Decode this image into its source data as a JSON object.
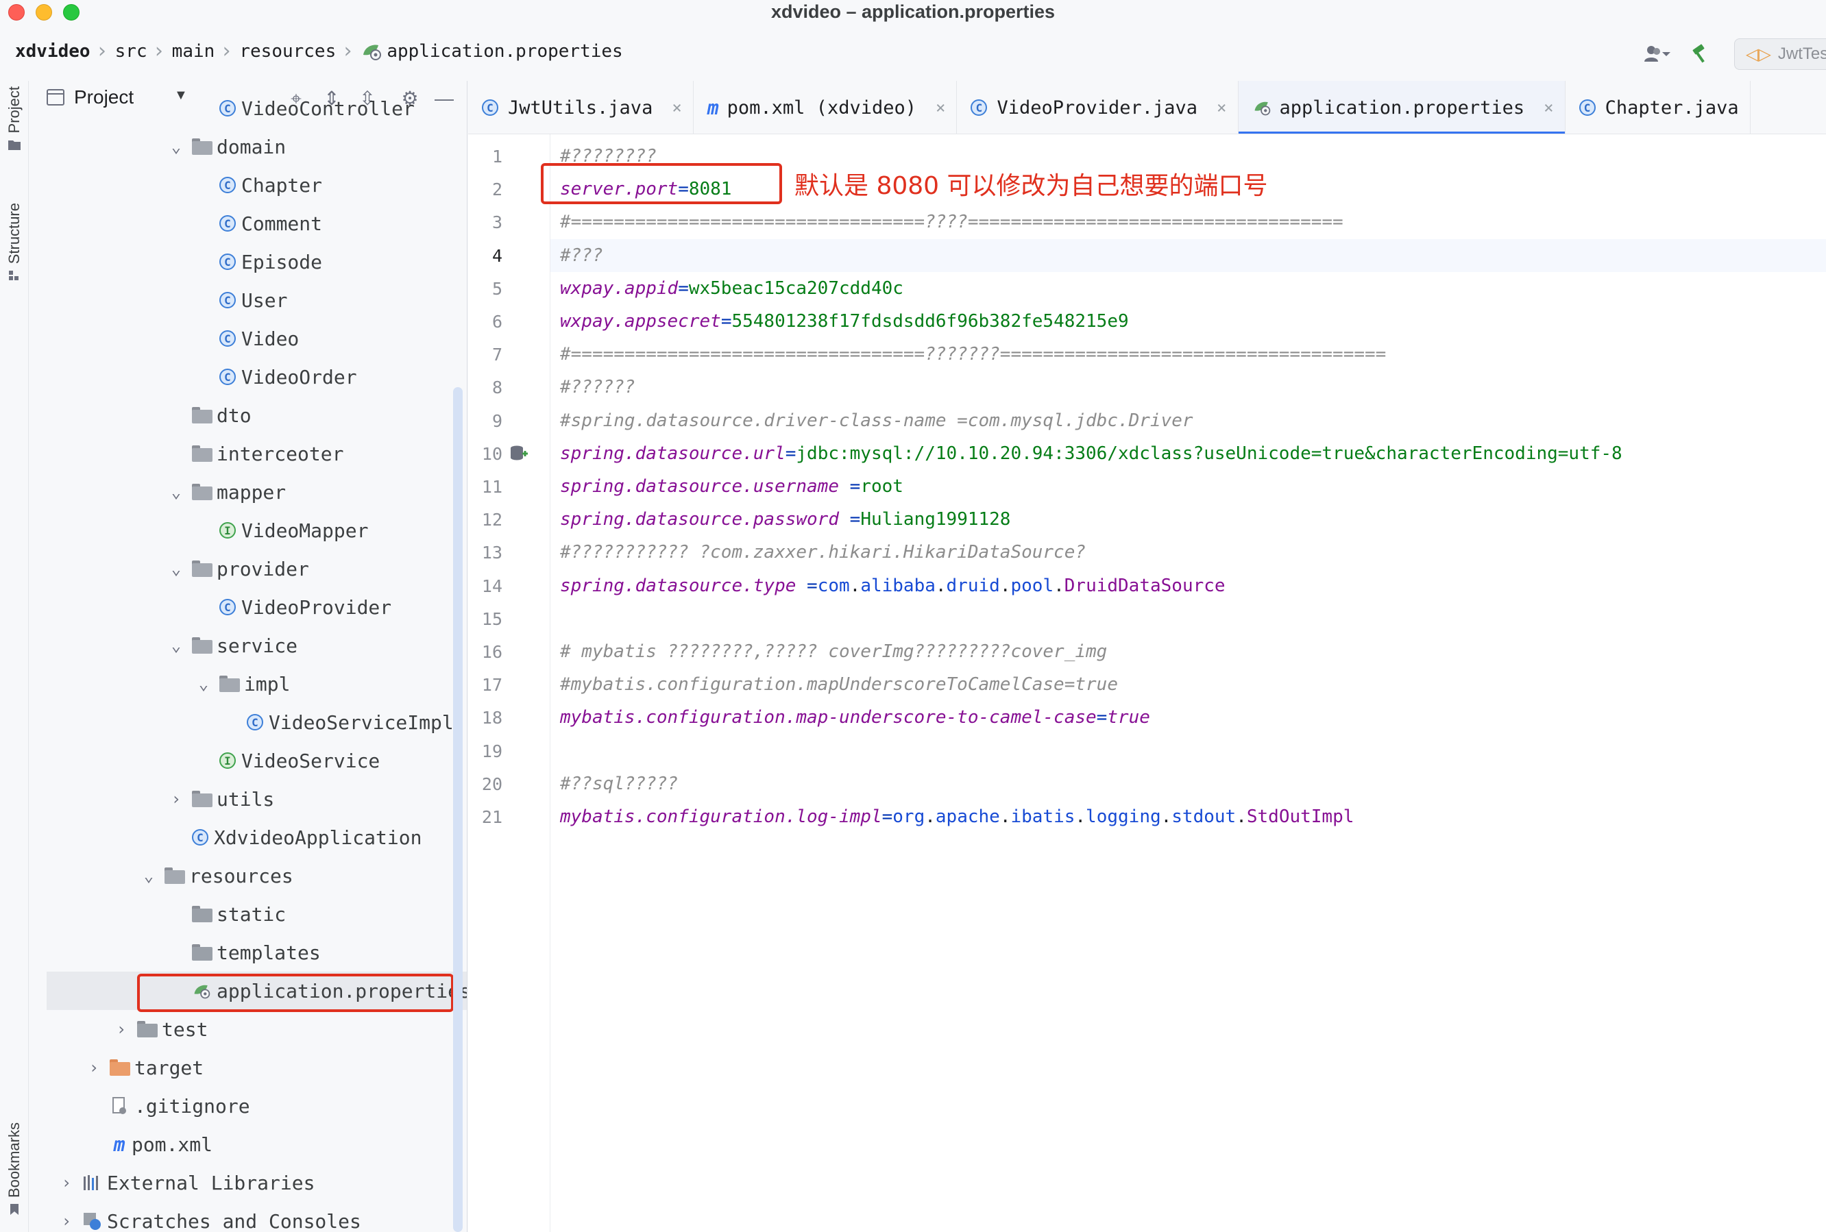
{
  "window": {
    "title": "xdvideo – application.properties"
  },
  "breadcrumb": [
    "xdvideo",
    "src",
    "main",
    "resources",
    "application.properties"
  ],
  "nav_right": {
    "run_config": "JwtTes"
  },
  "tool_strip": {
    "project_label": "Project",
    "structure_label": "Structure",
    "bookmarks_label": "Bookmarks"
  },
  "project_panel": {
    "title": "Project",
    "tree": [
      {
        "label": "VideoController",
        "type": "class",
        "indent": 3
      },
      {
        "label": "domain",
        "type": "package",
        "indent": 2,
        "expanded": true
      },
      {
        "label": "Chapter",
        "type": "class",
        "indent": 3
      },
      {
        "label": "Comment",
        "type": "class",
        "indent": 3
      },
      {
        "label": "Episode",
        "type": "class",
        "indent": 3
      },
      {
        "label": "User",
        "type": "class",
        "indent": 3
      },
      {
        "label": "Video",
        "type": "class",
        "indent": 3
      },
      {
        "label": "VideoOrder",
        "type": "class",
        "indent": 3
      },
      {
        "label": "dto",
        "type": "package",
        "indent": 2
      },
      {
        "label": "interceoter",
        "type": "package",
        "indent": 2
      },
      {
        "label": "mapper",
        "type": "package",
        "indent": 2,
        "expanded": true
      },
      {
        "label": "VideoMapper",
        "type": "interface",
        "indent": 3
      },
      {
        "label": "provider",
        "type": "package",
        "indent": 2,
        "expanded": true
      },
      {
        "label": "VideoProvider",
        "type": "class",
        "indent": 3
      },
      {
        "label": "service",
        "type": "package",
        "indent": 2,
        "expanded": true
      },
      {
        "label": "impl",
        "type": "package",
        "indent": 3,
        "expanded": true
      },
      {
        "label": "VideoServiceImpl",
        "type": "class",
        "indent": 4
      },
      {
        "label": "VideoService",
        "type": "interface",
        "indent": 3
      },
      {
        "label": "utils",
        "type": "package",
        "indent": 2,
        "collapsed": true
      },
      {
        "label": "XdvideoApplication",
        "type": "app",
        "indent": 2
      },
      {
        "label": "resources",
        "type": "resources",
        "indent": 1,
        "expanded": true
      },
      {
        "label": "static",
        "type": "folder",
        "indent": 2
      },
      {
        "label": "templates",
        "type": "folder",
        "indent": 2
      },
      {
        "label": "application.properties",
        "type": "properties",
        "indent": 2,
        "selected": true
      },
      {
        "label": "test",
        "type": "folder",
        "indent": 0,
        "collapsed": true
      },
      {
        "label": "target",
        "type": "orange-folder",
        "indent": -1,
        "collapsed": true
      },
      {
        "label": ".gitignore",
        "type": "gitignore",
        "indent": -1
      },
      {
        "label": "pom.xml",
        "type": "maven",
        "indent": -1
      },
      {
        "label": "External Libraries",
        "type": "libs",
        "indent": -2,
        "collapsed": true
      },
      {
        "label": "Scratches and Consoles",
        "type": "scratch",
        "indent": -2,
        "collapsed": true
      }
    ]
  },
  "tabs": [
    {
      "label": "JwtUtils.java",
      "icon": "class-icon",
      "closable": true
    },
    {
      "label": "pom.xml (xdvideo)",
      "icon": "maven-icon",
      "closable": true
    },
    {
      "label": "VideoProvider.java",
      "icon": "class-icon",
      "closable": true
    },
    {
      "label": "application.properties",
      "icon": "properties-icon",
      "closable": true,
      "active": true
    },
    {
      "label": "Chapter.java",
      "icon": "class-icon",
      "closable": false
    }
  ],
  "editor": {
    "current_line": 4,
    "lines": [
      {
        "n": "1",
        "tokens": [
          [
            "c",
            "#????????"
          ]
        ]
      },
      {
        "n": "2",
        "tokens": [
          [
            "k",
            "server.port"
          ],
          [
            "eq",
            "="
          ],
          [
            "v",
            "8081"
          ]
        ]
      },
      {
        "n": "3",
        "tokens": [
          [
            "c",
            "#=================================????==================================="
          ]
        ]
      },
      {
        "n": "4",
        "tokens": [
          [
            "c",
            "#???"
          ]
        ]
      },
      {
        "n": "5",
        "tokens": [
          [
            "k",
            "wxpay.appid"
          ],
          [
            "eq",
            "="
          ],
          [
            "v",
            "wx5beac15ca207cdd40c"
          ]
        ]
      },
      {
        "n": "6",
        "tokens": [
          [
            "k",
            "wxpay.appsecret"
          ],
          [
            "eq",
            "="
          ],
          [
            "v",
            "554801238f17fdsdsdd6f96b382fe548215e9"
          ]
        ]
      },
      {
        "n": "7",
        "tokens": [
          [
            "c",
            "#=================================???????===================================="
          ]
        ]
      },
      {
        "n": "8",
        "tokens": [
          [
            "c",
            "#??????"
          ]
        ]
      },
      {
        "n": "9",
        "tokens": [
          [
            "c",
            "#spring.datasource.driver-class-name =com.mysql.jdbc.Driver"
          ]
        ]
      },
      {
        "n": "10",
        "tokens": [
          [
            "k",
            "spring.datasource.url"
          ],
          [
            "eq",
            "="
          ],
          [
            "v",
            "jdbc:mysql://10.10.20.94:3306/xdclass?useUnicode=true&characterEncoding=utf-8"
          ]
        ],
        "gutter_icon": "database-icon"
      },
      {
        "n": "11",
        "tokens": [
          [
            "k",
            "spring.datasource.username"
          ],
          [
            "eq",
            " ="
          ],
          [
            "v",
            "root"
          ]
        ]
      },
      {
        "n": "12",
        "tokens": [
          [
            "k",
            "spring.datasource.password"
          ],
          [
            "eq",
            " ="
          ],
          [
            "v",
            "Huliang1991128"
          ]
        ]
      },
      {
        "n": "13",
        "tokens": [
          [
            "c",
            "#??????????? ?com.zaxxer.hikari.HikariDataSource?"
          ]
        ]
      },
      {
        "n": "14",
        "tokens": [
          [
            "k",
            "spring.datasource.type"
          ],
          [
            "eq",
            " ="
          ],
          [
            "pkgv",
            "com"
          ],
          [
            "dark",
            "."
          ],
          [
            "pkgv",
            "alibaba"
          ],
          [
            "dark",
            "."
          ],
          [
            "pkgv",
            "druid"
          ],
          [
            "dark",
            "."
          ],
          [
            "pkgv",
            "pool"
          ],
          [
            "dark",
            "."
          ],
          [
            "clsv",
            "DruidDataSource"
          ]
        ]
      },
      {
        "n": "15",
        "tokens": []
      },
      {
        "n": "16",
        "tokens": [
          [
            "c",
            "# mybatis ????????,????? coverImg?????????cover_img"
          ]
        ]
      },
      {
        "n": "17",
        "tokens": [
          [
            "c",
            "#mybatis.configuration.mapUnderscoreToCamelCase=true"
          ]
        ]
      },
      {
        "n": "18",
        "tokens": [
          [
            "k",
            "mybatis.configuration.map-underscore-to-camel-case"
          ],
          [
            "eq",
            "="
          ],
          [
            "k2",
            "true"
          ]
        ]
      },
      {
        "n": "19",
        "tokens": []
      },
      {
        "n": "20",
        "tokens": [
          [
            "c",
            "#??sql?????"
          ]
        ]
      },
      {
        "n": "21",
        "tokens": [
          [
            "k",
            "mybatis.configuration.log-impl"
          ],
          [
            "eq",
            "="
          ],
          [
            "pkgv",
            "org"
          ],
          [
            "dark",
            "."
          ],
          [
            "pkgv",
            "apache"
          ],
          [
            "dark",
            "."
          ],
          [
            "pkgv",
            "ibatis"
          ],
          [
            "dark",
            "."
          ],
          [
            "pkgv",
            "logging"
          ],
          [
            "dark",
            "."
          ],
          [
            "pkgv",
            "stdout"
          ],
          [
            "dark",
            "."
          ],
          [
            "clsv",
            "StdOutImpl"
          ]
        ]
      }
    ]
  },
  "annotation": {
    "text": "默认是 8080 可以修改为自己想要的端口号",
    "color": "#e0301e"
  },
  "colors": {
    "accent": "#3574f0",
    "highlight_red": "#e0301e",
    "key": "#871094",
    "value": "#067d17",
    "comment": "#8c8c8c"
  }
}
